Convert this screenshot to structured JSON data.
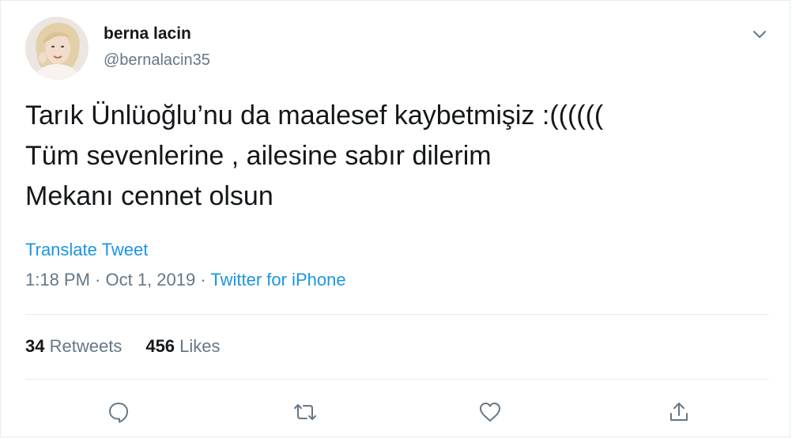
{
  "author": {
    "name": "berna lacin",
    "handle": "@bernalacin35",
    "avatar_icon": "profile-photo"
  },
  "tweet": {
    "lines": [
      "Tarık Ünlüoğlu’nu da maalesef kaybetmişiz :((((((",
      "Tüm sevenlerine , ailesine sabır dilerim",
      "Mekanı cennet olsun"
    ],
    "translate_label": "Translate Tweet",
    "time": "1:18 PM · Oct 1, 2019 · ",
    "source": "Twitter for iPhone"
  },
  "stats": {
    "retweets_count": "34",
    "retweets_label": "Retweets",
    "likes_count": "456",
    "likes_label": "Likes"
  },
  "actions": {
    "reply_icon": "speech-bubble-icon",
    "retweet_icon": "retweet-arrows-icon",
    "like_icon": "heart-icon",
    "share_icon": "share-upload-icon"
  },
  "colors": {
    "link": "#1b95e0",
    "secondary_text": "#657786",
    "primary_text": "#14171a",
    "border": "#e6ecf0"
  }
}
